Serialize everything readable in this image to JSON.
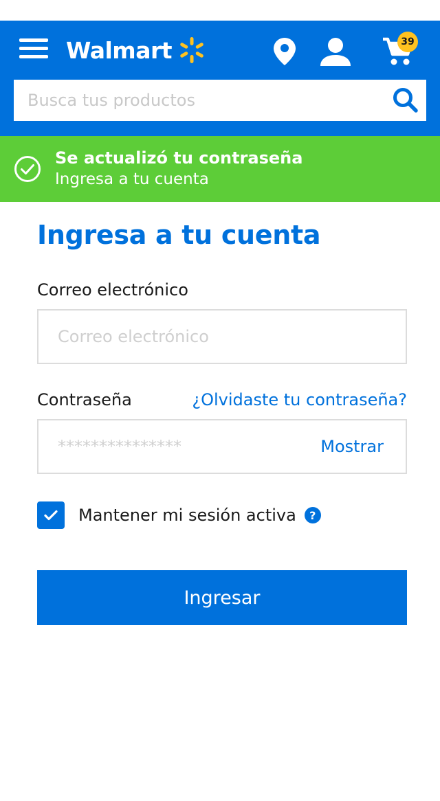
{
  "header": {
    "logo_text": "Walmart",
    "logo_icon": "spark-icon",
    "cart_count": "39",
    "icons": [
      "menu-icon",
      "location-pin-icon",
      "user-icon",
      "cart-icon",
      "search-icon"
    ]
  },
  "search": {
    "placeholder": "Busca tus productos"
  },
  "banner": {
    "title": "Se actualizó tu contraseña",
    "subtitle": "Ingresa a tu cuenta"
  },
  "form": {
    "title": "Ingresa a tu cuenta",
    "email_label": "Correo electrónico",
    "email_placeholder": "Correo electrónico",
    "password_label": "Contraseña",
    "password_placeholder": "***************",
    "forgot_link": "¿Olvidaste tu contraseña?",
    "show_label": "Mostrar",
    "remember_label": "Mantener mi sesión activa",
    "remember_checked": true,
    "help_symbol": "?",
    "submit_label": "Ingresar"
  },
  "colors": {
    "brand_blue": "#0071dc",
    "spark_yellow": "#ffc220",
    "success_green": "#5dcd38"
  }
}
